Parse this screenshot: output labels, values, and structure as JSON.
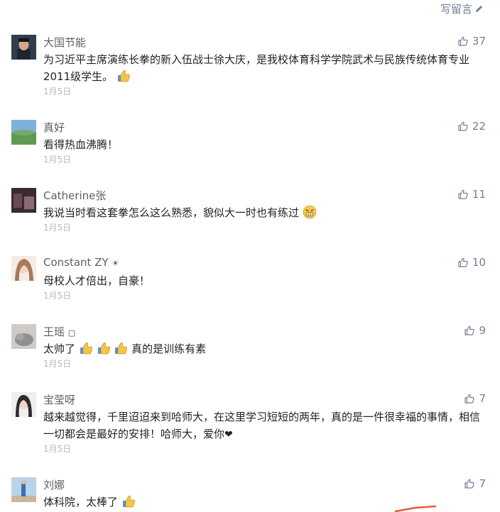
{
  "header": {
    "write_label": "写留言"
  },
  "comments": [
    {
      "name": "大国节能",
      "likes": "37",
      "text": "为习近平主席演练长拳的新入伍战士徐大庆，是我校体育科学学院武术与民族传统体育专业2011级学生。",
      "date": "1月5日"
    },
    {
      "name": "真好",
      "likes": "22",
      "text": "看得热血沸腾！",
      "date": "1月5日"
    },
    {
      "name": "Catherine张",
      "likes": "11",
      "text": "我说当时看这套拳怎么这么熟悉，貌似大一时也有练过",
      "date": "1月5日"
    },
    {
      "name": "Constant ZY",
      "name_suffix": "☀",
      "likes": "10",
      "text": "母校人才倍出，自豪！",
      "date": "1月5日"
    },
    {
      "name": "王瑶",
      "name_suffix": "▢",
      "likes": "9",
      "text_a": "太帅了",
      "text_b": "真的是训练有素",
      "date": "1月5日"
    },
    {
      "name": "宝莹呀",
      "likes": "7",
      "text": "越来越觉得，千里迢迢来到哈师大，在这里学习短短的两年，真的是一件很幸福的事情，相信一切都会是最好的安排！哈师大，爱你",
      "heart": "❤",
      "date": "1月5日"
    },
    {
      "name": "刘娜",
      "likes": "7",
      "text": "体科院，太棒了"
    }
  ]
}
